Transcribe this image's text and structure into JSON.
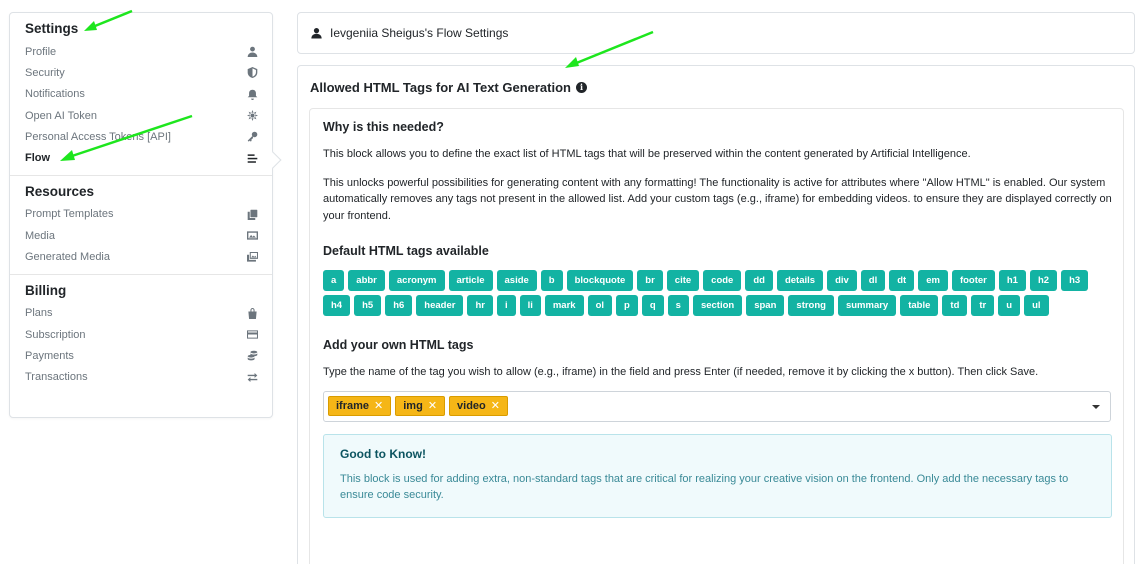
{
  "sidebar": {
    "settings": {
      "title": "Settings",
      "items": [
        {
          "label": "Profile",
          "icon": "user-icon"
        },
        {
          "label": "Security",
          "icon": "shield-icon"
        },
        {
          "label": "Notifications",
          "icon": "bell-icon"
        },
        {
          "label": "Open AI Token",
          "icon": "openai-icon"
        },
        {
          "label": "Personal Access Tokens [API]",
          "icon": "key-icon"
        },
        {
          "label": "Flow",
          "icon": "bars-icon",
          "active": true
        }
      ]
    },
    "resources": {
      "title": "Resources",
      "items": [
        {
          "label": "Prompt Templates",
          "icon": "copy-icon"
        },
        {
          "label": "Media",
          "icon": "image-icon"
        },
        {
          "label": "Generated Media",
          "icon": "images-icon"
        }
      ]
    },
    "billing": {
      "title": "Billing",
      "items": [
        {
          "label": "Plans",
          "icon": "bag-icon"
        },
        {
          "label": "Subscription",
          "icon": "card-icon"
        },
        {
          "label": "Payments",
          "icon": "coins-icon"
        },
        {
          "label": "Transactions",
          "icon": "exchange-icon"
        }
      ]
    }
  },
  "header": {
    "title": "Ievgeniia Sheigus's Flow Settings",
    "icon": "user-icon"
  },
  "main": {
    "title": "Allowed HTML Tags for AI Text Generation",
    "why_title": "Why is this needed?",
    "why_p1": "This block allows you to define the exact list of HTML tags that will be preserved within the content generated by Artificial Intelligence.",
    "why_p2": "This unlocks powerful possibilities for generating content with any formatting! The functionality is active for attributes where \"Allow HTML\" is enabled. Our system automatically removes any tags not present in the allowed list. Add your custom tags (e.g., iframe) for embedding videos. to ensure they are displayed correctly on your frontend.",
    "default_title": "Default HTML tags available",
    "default_tags": [
      "a",
      "abbr",
      "acronym",
      "article",
      "aside",
      "b",
      "blockquote",
      "br",
      "cite",
      "code",
      "dd",
      "details",
      "div",
      "dl",
      "dt",
      "em",
      "footer",
      "h1",
      "h2",
      "h3",
      "h4",
      "h5",
      "h6",
      "header",
      "hr",
      "i",
      "li",
      "mark",
      "ol",
      "p",
      "q",
      "s",
      "section",
      "span",
      "strong",
      "summary",
      "table",
      "td",
      "tr",
      "u",
      "ul"
    ],
    "own_title": "Add your own HTML tags",
    "own_desc": "Type the name of the tag you wish to allow (e.g., iframe) in the field and press Enter (if needed, remove it by clicking the x button). Then click Save.",
    "user_tags": [
      "iframe",
      "img",
      "video"
    ],
    "remove_glyph": "✕",
    "good_title": "Good to Know!",
    "good_text": "This block is used for adding extra, non-standard tags that are critical for realizing your creative vision on the frontend. Only add the necessary tags to ensure code security."
  },
  "colors": {
    "tag_bg": "#13b3a3",
    "user_tag_bg": "#f5b617",
    "annotation_arrow": "#1ee61e"
  }
}
